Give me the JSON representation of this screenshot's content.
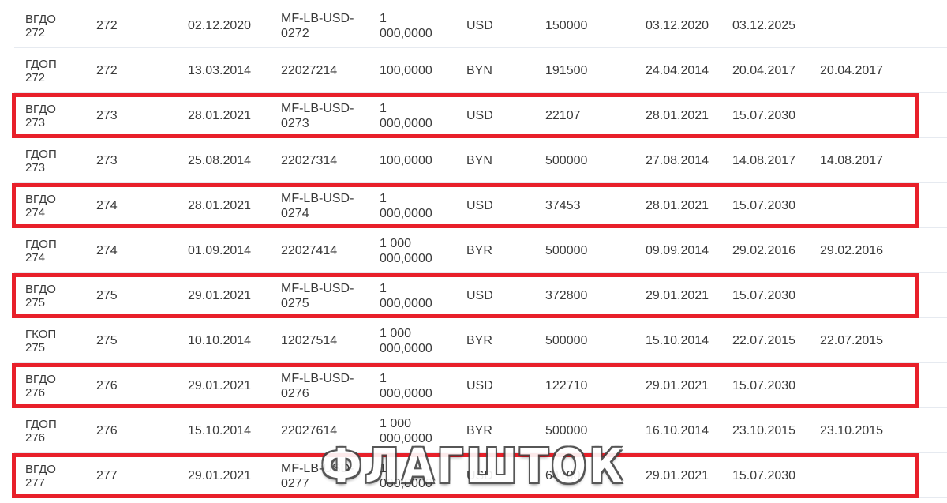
{
  "rows": [
    {
      "cells": [
        "ВГДО\n272",
        "272",
        "02.12.2020",
        "MF-LB-USD-\n0272",
        "1\n000,0000",
        "USD",
        "150000",
        "03.12.2020",
        "03.12.2025",
        ""
      ],
      "highlighted": false
    },
    {
      "cells": [
        "ГДОП\n272",
        "272",
        "13.03.2014",
        "22027214",
        "100,0000",
        "BYN",
        "191500",
        "24.04.2014",
        "20.04.2017",
        "20.04.2017"
      ],
      "highlighted": false
    },
    {
      "cells": [
        "ВГДО\n273",
        "273",
        "28.01.2021",
        "MF-LB-USD-\n0273",
        "1\n000,0000",
        "USD",
        "22107",
        "28.01.2021",
        "15.07.2030",
        ""
      ],
      "highlighted": true
    },
    {
      "cells": [
        "ГДОП\n273",
        "273",
        "25.08.2014",
        "22027314",
        "100,0000",
        "BYN",
        "500000",
        "27.08.2014",
        "14.08.2017",
        "14.08.2017"
      ],
      "highlighted": false
    },
    {
      "cells": [
        "ВГДО\n274",
        "274",
        "28.01.2021",
        "MF-LB-USD-\n0274",
        "1\n000,0000",
        "USD",
        "37453",
        "28.01.2021",
        "15.07.2030",
        ""
      ],
      "highlighted": true
    },
    {
      "cells": [
        "ГДОП\n274",
        "274",
        "01.09.2014",
        "22027414",
        "1 000\n000,0000",
        "BYR",
        "500000",
        "09.09.2014",
        "29.02.2016",
        "29.02.2016"
      ],
      "highlighted": false
    },
    {
      "cells": [
        "ВГДО\n275",
        "275",
        "29.01.2021",
        "MF-LB-USD-\n0275",
        "1\n000,0000",
        "USD",
        "372800",
        "29.01.2021",
        "15.07.2030",
        ""
      ],
      "highlighted": true
    },
    {
      "cells": [
        "ГКОП\n275",
        "275",
        "10.10.2014",
        "12027514",
        "1 000\n000,0000",
        "BYR",
        "500000",
        "15.10.2014",
        "22.07.2015",
        "22.07.2015"
      ],
      "highlighted": false
    },
    {
      "cells": [
        "ВГДО\n276",
        "276",
        "29.01.2021",
        "MF-LB-USD-\n0276",
        "1\n000,0000",
        "USD",
        "122710",
        "29.01.2021",
        "15.07.2030",
        ""
      ],
      "highlighted": true
    },
    {
      "cells": [
        "ГДОП\n276",
        "276",
        "15.10.2014",
        "22027614",
        "1 000\n000,0000",
        "BYR",
        "500000",
        "16.10.2014",
        "23.10.2015",
        "23.10.2015"
      ],
      "highlighted": false
    },
    {
      "cells": [
        "ВГДО\n277",
        "277",
        "29.01.2021",
        "MF-LB-USD-\n0277",
        "1\n000,0000",
        "USD",
        "64100",
        "29.01.2021",
        "15.07.2030",
        ""
      ],
      "highlighted": true
    }
  ],
  "watermark": "ФЛАГШТОК",
  "colors": {
    "highlight": "#e8202a",
    "text": "#3a3a3a",
    "row_divider": "#e6eaf0"
  }
}
